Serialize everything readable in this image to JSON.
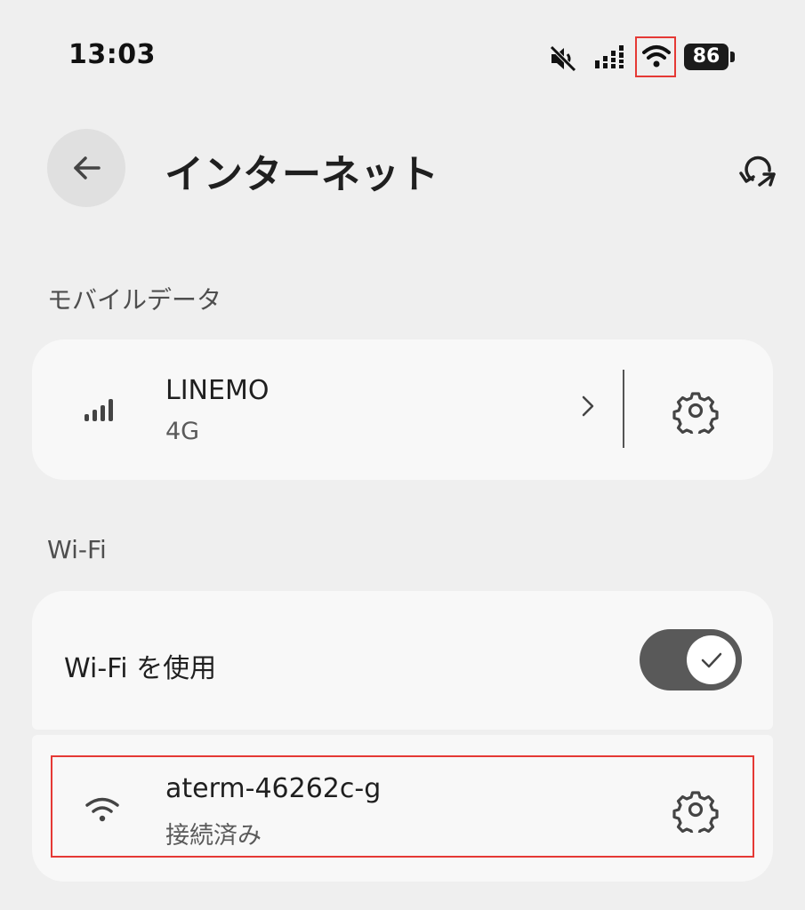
{
  "status_bar": {
    "time": "13:03",
    "battery": "86",
    "icons": [
      "mute-icon",
      "signal-icon",
      "wifi-icon",
      "battery-icon"
    ]
  },
  "header": {
    "title": "インターネット",
    "back_icon": "arrow-left-icon",
    "action_icon": "reset-icon"
  },
  "mobile_data": {
    "section_label": "モバイルデータ",
    "carrier_name": "LINEMO",
    "network_type": "4G",
    "chevron": "›"
  },
  "wifi": {
    "section_label": "Wi-Fi",
    "toggle_label": "Wi-Fi を使用",
    "toggle_on": true,
    "network_name": "aterm-46262c-g",
    "network_status": "接続済み"
  },
  "colors": {
    "background": "#efefef",
    "card": "#f8f8f8",
    "toggle_track": "#595959",
    "highlight": "#e53935"
  }
}
